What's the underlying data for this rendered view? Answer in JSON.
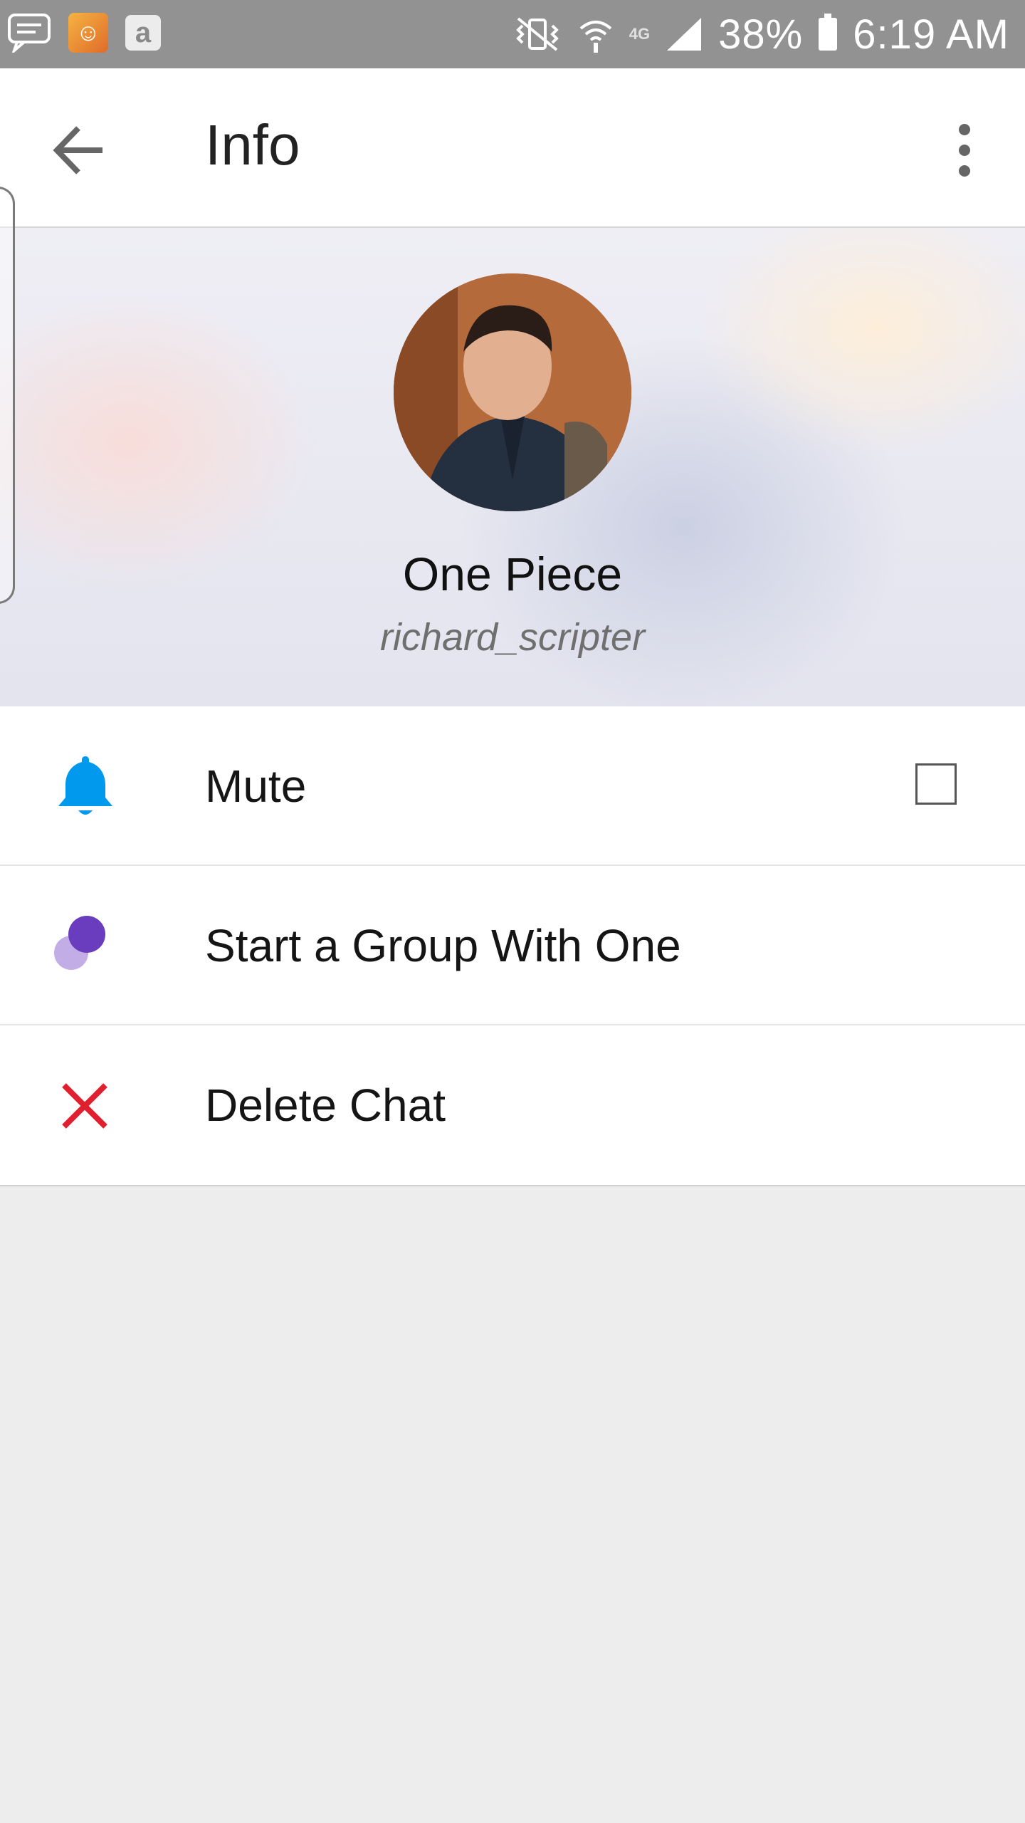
{
  "status_bar": {
    "battery": "38%",
    "time": "6:19 AM",
    "network": "4G"
  },
  "app_bar": {
    "title": "Info"
  },
  "profile": {
    "name": "One Piece",
    "username": "richard_scripter"
  },
  "list": [
    {
      "label": "Mute",
      "icon": "bell-icon",
      "color": "#0099ee",
      "checked": false
    },
    {
      "label": "Start a Group With One",
      "icon": "group-dots-icon",
      "color": "#6a3dbf"
    },
    {
      "label": "Delete Chat",
      "icon": "close-x-icon",
      "color": "#e0202e"
    }
  ]
}
